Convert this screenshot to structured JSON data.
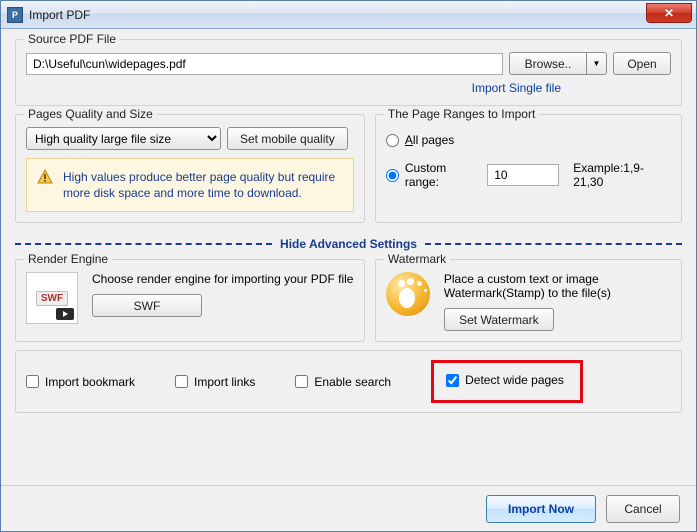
{
  "window": {
    "title": "Import PDF",
    "close_tooltip": "Close"
  },
  "source": {
    "legend": "Source PDF File",
    "path": "D:\\Useful\\cun\\widepages.pdf",
    "browse": "Browse..",
    "open": "Open",
    "import_single": "Import Single file"
  },
  "quality": {
    "legend": "Pages Quality and Size",
    "selected": "High quality large file size",
    "set_mobile": "Set mobile quality",
    "info": "High values produce better page quality but require more disk space and more time to download."
  },
  "ranges": {
    "legend": "The Page Ranges to Import",
    "all": "All pages",
    "custom": "Custom range:",
    "value": "10",
    "example": "Example:1,9-21,30",
    "selected": "custom"
  },
  "advanced_toggle": "Hide Advanced Settings",
  "render": {
    "legend": "Render Engine",
    "desc": "Choose render engine for importing your PDF file",
    "swf_btn": "SWF",
    "icon_label": "SWF"
  },
  "watermark": {
    "legend": "Watermark",
    "desc": "Place a custom text or image Watermark(Stamp) to the file(s)",
    "btn": "Set Watermark"
  },
  "checks": {
    "bookmark": "Import bookmark",
    "links": "Import links",
    "search": "Enable search",
    "wide": "Detect wide pages",
    "bookmark_checked": false,
    "links_checked": false,
    "search_checked": false,
    "wide_checked": true
  },
  "footer": {
    "import": "Import Now",
    "cancel": "Cancel"
  }
}
